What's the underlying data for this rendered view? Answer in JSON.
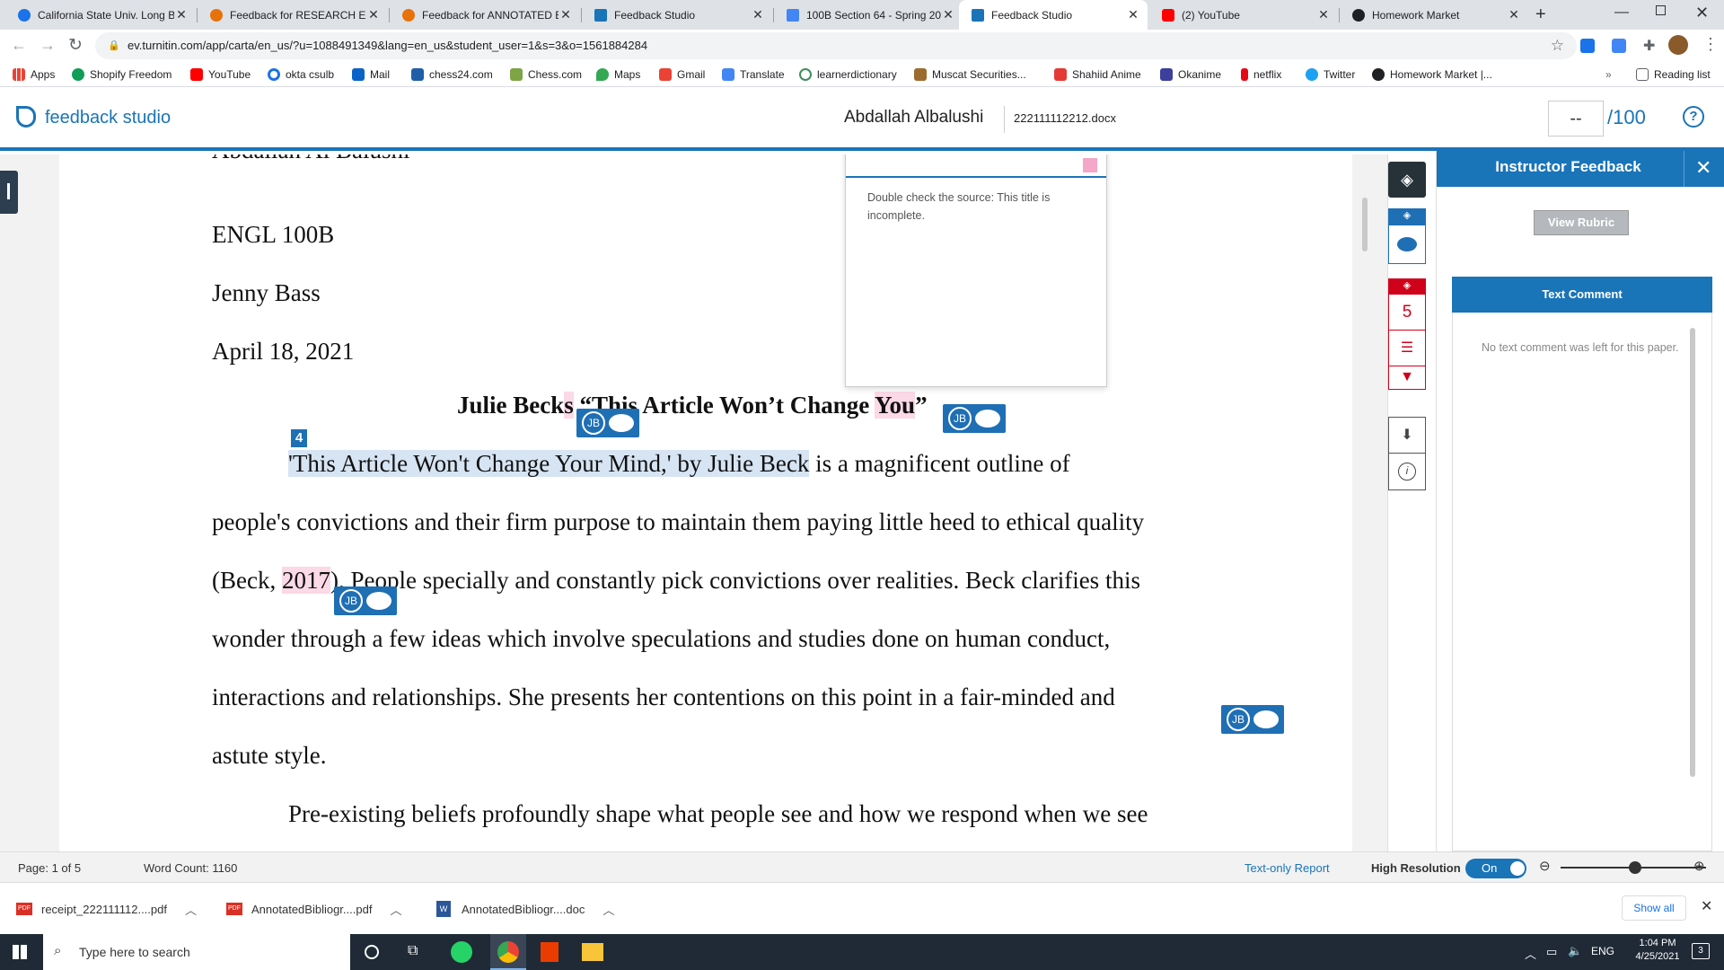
{
  "tabs": [
    {
      "title": "California State Univ. Long B",
      "color": "#1a73e8"
    },
    {
      "title": "Feedback for RESEARCH ES",
      "color": "#e8710a"
    },
    {
      "title": "Feedback for ANNOTATED B",
      "color": "#e8710a"
    },
    {
      "title": "Feedback Studio",
      "color": "#1a74b8"
    },
    {
      "title": "100B Section 64 - Spring 20",
      "color": "#4285f4"
    },
    {
      "title": "Feedback Studio",
      "color": "#1a74b8"
    },
    {
      "title": "(2) YouTube",
      "color": "#ff0000"
    },
    {
      "title": "Homework Market",
      "color": "#202124"
    }
  ],
  "address": {
    "url": "ev.turnitin.com/app/carta/en_us/?u=1088491349&lang=en_us&student_user=1&s=3&o=1561884284"
  },
  "bookmarks": [
    {
      "label": "Apps"
    },
    {
      "label": "Shopify Freedom"
    },
    {
      "label": "YouTube"
    },
    {
      "label": "okta csulb"
    },
    {
      "label": "Mail"
    },
    {
      "label": "chess24.com"
    },
    {
      "label": "Chess.com"
    },
    {
      "label": "Maps"
    },
    {
      "label": "Gmail"
    },
    {
      "label": "Translate"
    },
    {
      "label": "learnerdictionary"
    },
    {
      "label": "Muscat Securities..."
    },
    {
      "label": "Shahiid Anime"
    },
    {
      "label": "Okanime"
    },
    {
      "label": "netflix"
    },
    {
      "label": "Twitter"
    },
    {
      "label": "Homework Market |..."
    }
  ],
  "reading_list": "Reading list",
  "header": {
    "logo": "feedback studio",
    "student": "Abdallah Albalushi",
    "filename": "222111112212.docx",
    "grade": "--",
    "grade_max": "/100"
  },
  "doc": {
    "partial_top": "Abdallah Al Balushi",
    "course": "ENGL 100B",
    "instructor": "Jenny Bass",
    "date": "April 18, 2021",
    "title_a": "Julie Beck",
    "title_b": "s",
    "title_c": " “This Article Won’t Change ",
    "title_d": "You",
    "title_e": "”",
    "marker": "4",
    "p1_hl": "'This Article Won't Change Your Mind,' by Julie Beck",
    "p1_rest": " is a magnificent outline of",
    "p2": "people's convictions and their firm purpose to maintain them paying little heed to ethical quality",
    "p3_a": "(Beck, ",
    "p3_b": "2017",
    "p3_c": "). People specially and constantly pick convictions over realities. Beck clarifies this",
    "p4": "wonder through a few ideas which involve speculations and studies done on human conduct,",
    "p5": "interactions and relationships. She presents her contentions on this point in a fair-minded and",
    "p6": "astute style.",
    "p7": "Pre-existing beliefs profoundly shape what people see and how we respond when we see"
  },
  "comment_popup": {
    "text": "Double check the source: This title is incomplete."
  },
  "bubbles": {
    "initials": "JB"
  },
  "sidebar": {
    "count": "5"
  },
  "panel": {
    "title": "Instructor Feedback",
    "rubric": "View Rubric",
    "text_comment": "Text Comment",
    "no_comment": "No text comment was left for this paper."
  },
  "status": {
    "page": "Page: 1 of 5",
    "words": "Word Count: 1160",
    "text_only": "Text-only Report",
    "high_res": "High Resolution",
    "toggle": "On"
  },
  "downloads": [
    {
      "name": "receipt_222111112....pdf"
    },
    {
      "name": "AnnotatedBibliogr....pdf"
    },
    {
      "name": "AnnotatedBibliogr....doc"
    }
  ],
  "show_all": "Show all",
  "taskbar": {
    "search": "Type here to search",
    "lang": "ENG",
    "time": "1:04 PM",
    "date": "4/25/2021"
  }
}
